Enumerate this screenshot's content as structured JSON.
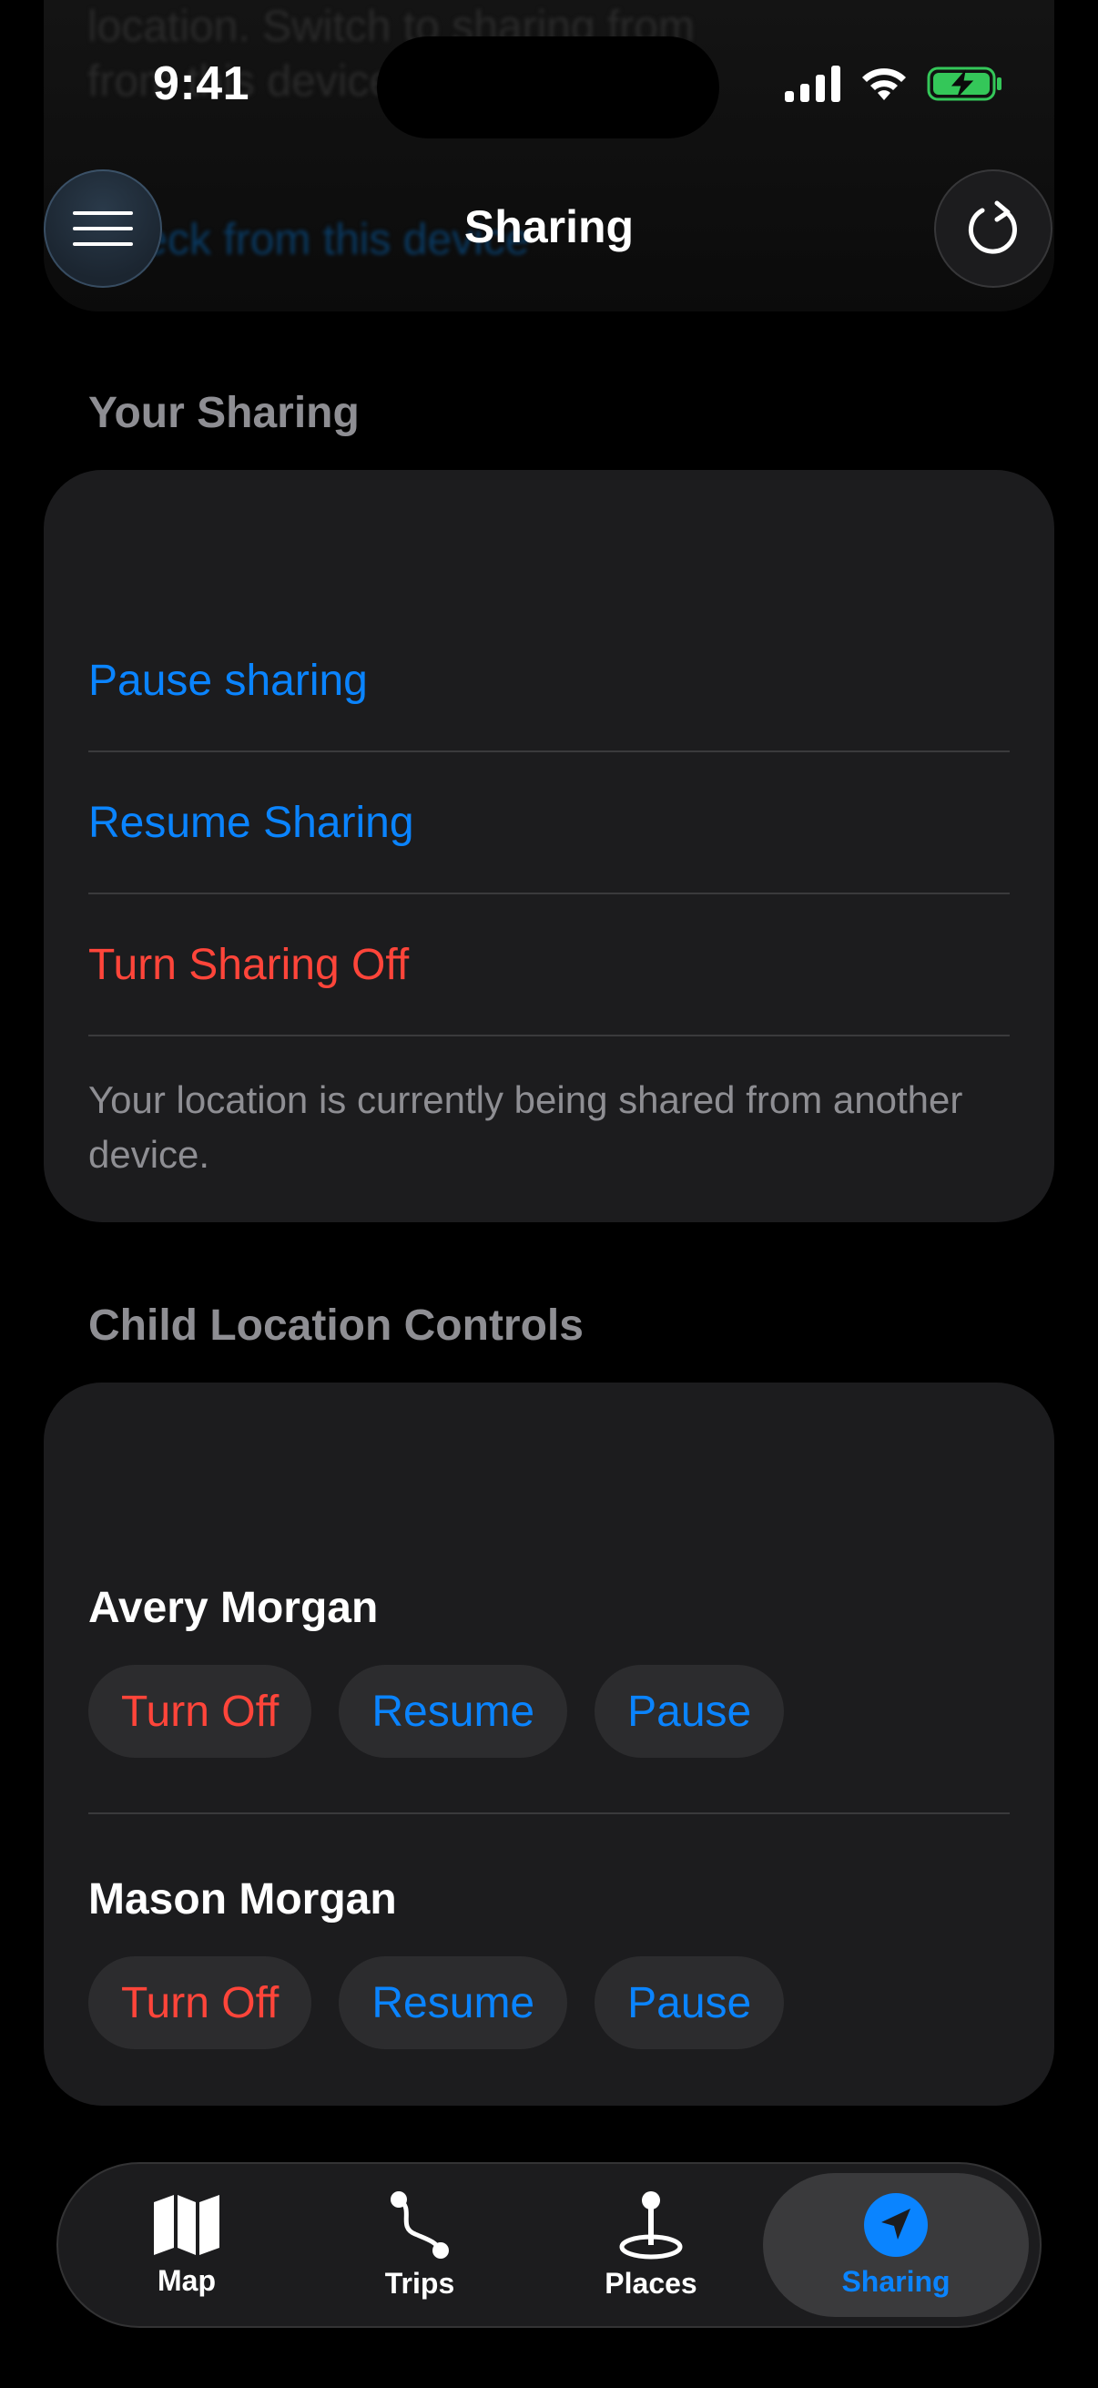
{
  "status_bar": {
    "time": "9:41"
  },
  "background_ghost": {
    "lines": [
      "location. Switch to sharing from",
      "from this device"
    ],
    "link": "Check from this device"
  },
  "header": {
    "title": "Sharing",
    "menu_icon": "hamburger-icon",
    "refresh_icon": "refresh-icon"
  },
  "your_sharing": {
    "section_title": "Your Sharing",
    "actions": [
      {
        "label": "Pause sharing",
        "color": "#0a84ff"
      },
      {
        "label": "Resume Sharing",
        "color": "#0a84ff"
      },
      {
        "label": "Turn Sharing Off",
        "color": "#ff453a"
      }
    ],
    "footnote": "Your location is currently being shared from another device."
  },
  "child_controls": {
    "section_title": "Child Location Controls",
    "children": [
      {
        "name": "Avery Morgan",
        "buttons": [
          "Turn Off",
          "Resume",
          "Pause"
        ]
      },
      {
        "name": "Mason Morgan",
        "buttons": [
          "Turn Off",
          "Resume",
          "Pause"
        ]
      }
    ]
  },
  "tab_bar": {
    "tabs": [
      {
        "label": "Map",
        "icon": "map-icon",
        "active": false
      },
      {
        "label": "Trips",
        "icon": "route-icon",
        "active": false
      },
      {
        "label": "Places",
        "icon": "pin-icon",
        "active": false
      },
      {
        "label": "Sharing",
        "icon": "location-arrow-icon",
        "active": true
      }
    ]
  },
  "colors": {
    "accent": "#0a84ff",
    "destructive": "#ff453a",
    "card": "#1c1c1e",
    "battery": "#34c759"
  }
}
